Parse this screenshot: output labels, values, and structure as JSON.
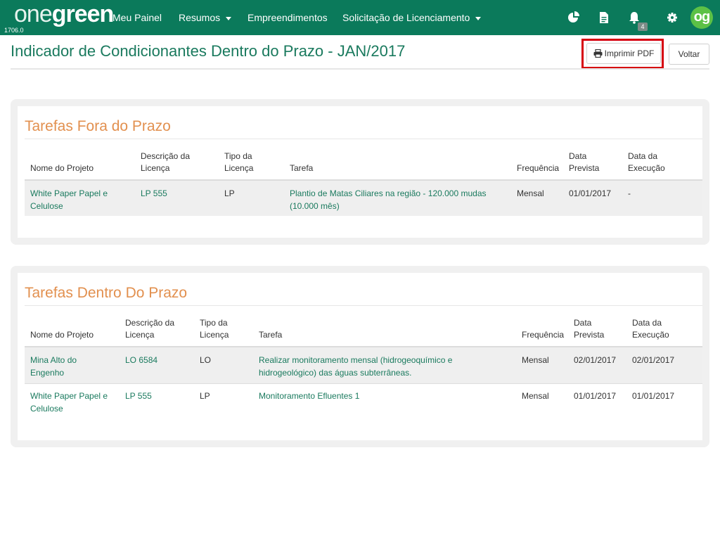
{
  "header": {
    "brand_one": "one",
    "brand_green": "green",
    "version": "1706.0",
    "nav": [
      "Meu Painel",
      "Resumos",
      "Empreendimentos",
      "Solicitação de Licenciamento"
    ],
    "notification_count": "4",
    "avatar_initials": "og"
  },
  "page": {
    "title": "Indicador de Condicionantes Dentro do Prazo - JAN/2017",
    "print_button": "Imprimir PDF",
    "back_button": "Voltar"
  },
  "out_of_deadline": {
    "heading": "Tarefas Fora do Prazo",
    "columns": {
      "project": "Nome do Projeto",
      "license_desc_1": "Descrição da",
      "license_desc_2": "Licença",
      "license_type_1": "Tipo da",
      "license_type_2": "Licença",
      "task": "Tarefa",
      "frequency": "Frequência",
      "planned_1": "Data",
      "planned_2": "Prevista",
      "executed_1": "Data da",
      "executed_2": "Execução"
    },
    "rows": [
      {
        "project_1": "White Paper Papel e",
        "project_2": "Celulose",
        "license": "LP 555",
        "type": "LP",
        "task_1": "Plantio de Matas Ciliares na região - 120.000 mudas",
        "task_2": "(10.000 mês)",
        "frequency": "Mensal",
        "planned": "01/01/2017",
        "executed": "-"
      }
    ]
  },
  "within_deadline": {
    "heading": "Tarefas Dentro Do Prazo",
    "columns": {
      "project": "Nome do Projeto",
      "license_desc_1": "Descrição da",
      "license_desc_2": "Licença",
      "license_type_1": "Tipo da",
      "license_type_2": "Licença",
      "task": "Tarefa",
      "frequency": "Frequência",
      "planned_1": "Data",
      "planned_2": "Prevista",
      "executed_1": "Data da",
      "executed_2": "Execução"
    },
    "rows": [
      {
        "project_1": "Mina Alto do",
        "project_2": "Engenho",
        "license": "LO 6584",
        "type": "LO",
        "task_1": "Realizar monitoramento mensal (hidrogeoquímico e",
        "task_2": "hidrogeológico) das águas subterrâneas.",
        "frequency": "Mensal",
        "planned": "02/01/2017",
        "executed": "02/01/2017"
      },
      {
        "project_1": "White Paper Papel e",
        "project_2": "Celulose",
        "license": "LP 555",
        "type": "LP",
        "task_1": "Monitoramento Efluentes 1",
        "task_2": "",
        "frequency": "Mensal",
        "planned": "01/01/2017",
        "executed": "01/01/2017"
      }
    ]
  },
  "colors": {
    "navbar": "#0b7a5b",
    "title": "#1a7a5e",
    "section_heading": "#e2904f",
    "highlight": "#d6000e",
    "avatar": "#5cc146"
  },
  "icons": [
    "pie-chart-icon",
    "document-icon",
    "bell-icon",
    "gear-icon",
    "print-icon"
  ]
}
